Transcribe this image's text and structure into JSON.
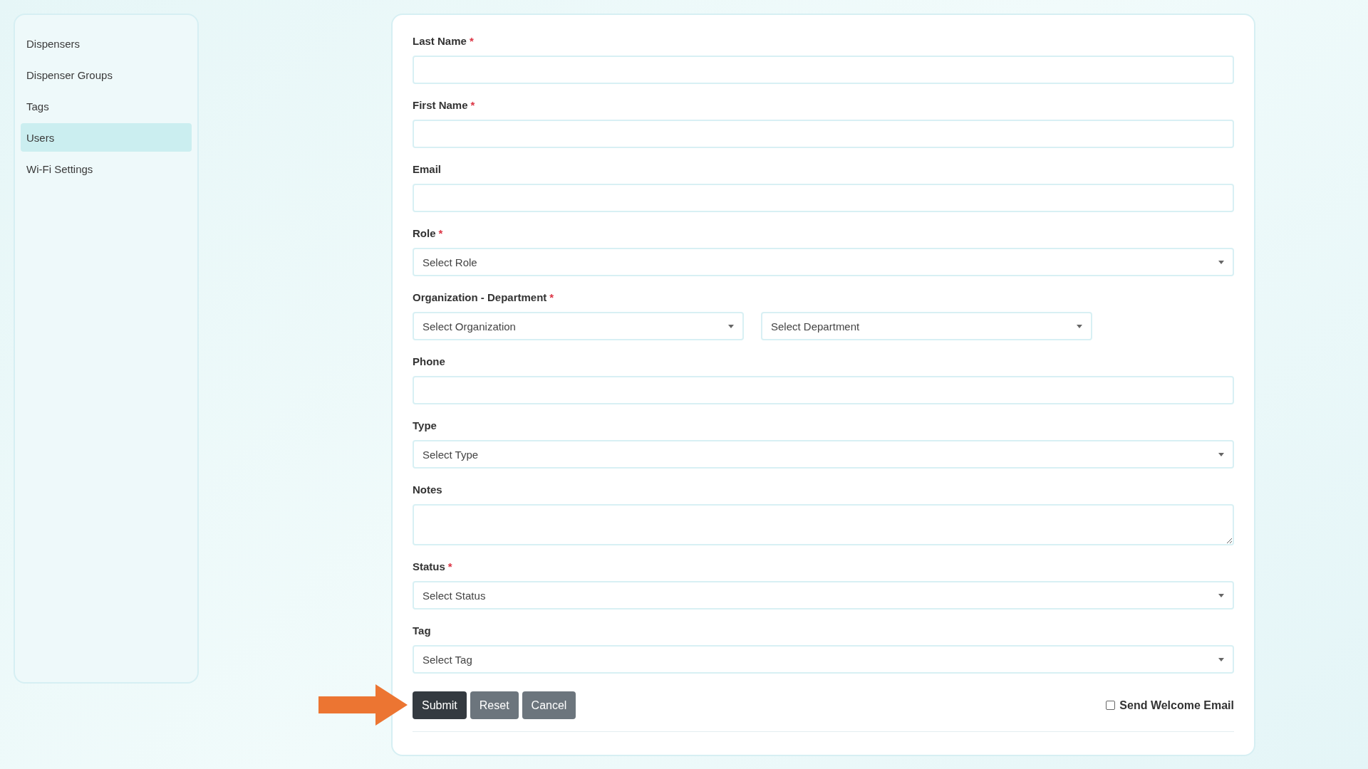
{
  "sidebar": {
    "items": [
      {
        "label": "Dispensers",
        "selected": false
      },
      {
        "label": "Dispenser Groups",
        "selected": false
      },
      {
        "label": "Tags",
        "selected": false
      },
      {
        "label": "Users",
        "selected": true
      },
      {
        "label": "Wi-Fi Settings",
        "selected": false
      }
    ]
  },
  "form": {
    "fields": [
      {
        "kind": "text",
        "label": "Last Name",
        "required_mark": "*"
      },
      {
        "kind": "text",
        "label": "First Name",
        "required_mark": "*"
      },
      {
        "kind": "text",
        "label": "Email"
      },
      {
        "kind": "select",
        "label": "Role",
        "required_mark": "*",
        "placeholder": "Select Role"
      },
      {
        "kind": "select_pair",
        "label": "Organization - Department",
        "required_mark": "*",
        "placeholders": [
          "Select Organization",
          "Select Department"
        ]
      },
      {
        "kind": "text",
        "label": "Phone"
      },
      {
        "kind": "select",
        "label": "Type",
        "placeholder": "Select Type"
      },
      {
        "kind": "textarea",
        "label": "Notes"
      },
      {
        "kind": "select",
        "label": "Status",
        "required_mark": "*",
        "placeholder": "Select Status"
      },
      {
        "kind": "select",
        "label": "Tag",
        "placeholder": "Select Tag"
      }
    ],
    "buttons": [
      {
        "label": "Submit",
        "kind": "primary"
      },
      {
        "label": "Reset",
        "kind": "secondary"
      },
      {
        "label": "Cancel",
        "kind": "secondary"
      }
    ],
    "welcome_email": {
      "label": "Send Welcome Email",
      "checked": false
    }
  }
}
